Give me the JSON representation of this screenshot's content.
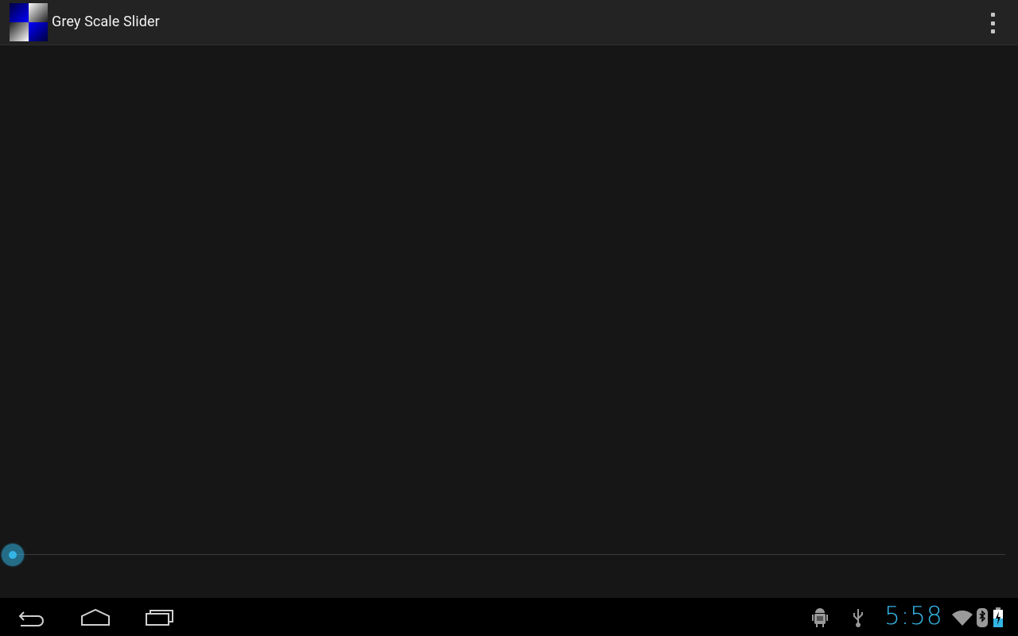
{
  "app": {
    "title": "Grey Scale Slider",
    "icon": "checker-quadrant-icon"
  },
  "actionbar": {
    "overflow_icon": "overflow-menu-icon"
  },
  "slider": {
    "value_fraction": 0,
    "accent_color": "#33b5e5"
  },
  "navigation": {
    "back_icon": "back-icon",
    "home_icon": "home-icon",
    "recents_icon": "recent-apps-icon"
  },
  "status": {
    "time": "5:58",
    "icons": [
      "android-debug-icon",
      "usb-icon",
      "wifi-icon",
      "bluetooth-icon",
      "battery-charging-icon"
    ]
  },
  "colors": {
    "background": "#161616",
    "actionbar": "#232323",
    "accent": "#33b5e5",
    "systembar": "#000000"
  }
}
